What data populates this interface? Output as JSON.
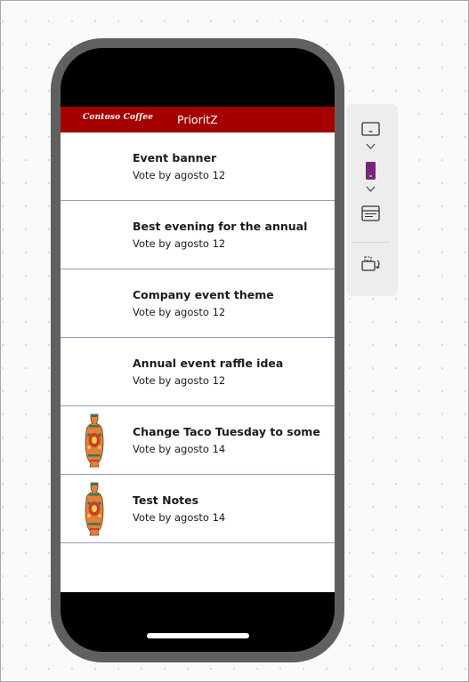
{
  "app": {
    "brand": "Contoso Coffee",
    "title": "PrioritZ"
  },
  "items": [
    {
      "title": "Event banner",
      "subtitle": "Vote by agosto 12",
      "has_image": false
    },
    {
      "title": "Best evening for the annual",
      "subtitle": "Vote by agosto 12",
      "has_image": false
    },
    {
      "title": "Company event theme",
      "subtitle": "Vote by agosto 12",
      "has_image": false
    },
    {
      "title": "Annual event raffle idea",
      "subtitle": "Vote by agosto 12",
      "has_image": false
    },
    {
      "title": "Change Taco Tuesday to some",
      "subtitle": "Vote by agosto 14",
      "has_image": true
    },
    {
      "title": "Test Notes",
      "subtitle": "Vote by agosto 14",
      "has_image": true
    }
  ],
  "toolbar": {
    "buttons": [
      {
        "name": "tablet-landscape-icon"
      },
      {
        "name": "chevron-down-icon"
      },
      {
        "name": "phone-portrait-icon",
        "active": true
      },
      {
        "name": "chevron-down-icon"
      },
      {
        "name": "screen-layout-icon"
      },
      {
        "name": "rotate-screen-icon"
      }
    ]
  },
  "colors": {
    "header_bg": "#a50000",
    "row_divider": "#9b9bc2",
    "phone_frame": "#606060",
    "active_device": "#742774"
  }
}
